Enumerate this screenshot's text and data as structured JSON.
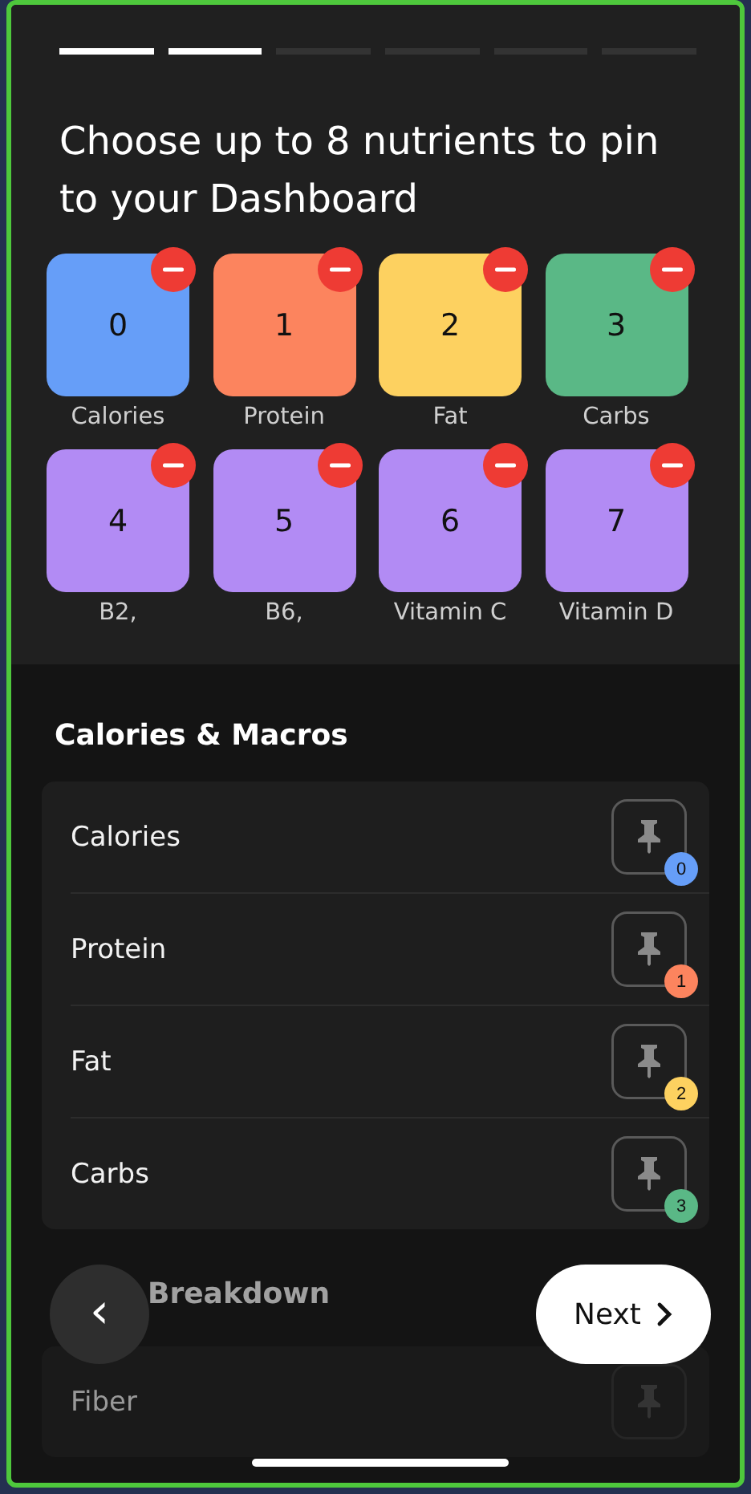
{
  "progress": [
    {
      "done": true
    },
    {
      "done": true
    },
    {
      "done": false
    },
    {
      "done": false
    },
    {
      "done": false
    },
    {
      "done": false
    }
  ],
  "title": "Choose up to 8 nutrients to pin to your Dashboard",
  "pinned": [
    {
      "index": "0",
      "label": "Calories",
      "color": "#669ef8"
    },
    {
      "index": "1",
      "label": "Protein",
      "color": "#fc845e"
    },
    {
      "index": "2",
      "label": "Fat",
      "color": "#fdd160"
    },
    {
      "index": "3",
      "label": "Carbs",
      "color": "#5ab886"
    },
    {
      "index": "4",
      "label": "B2,",
      "color": "#b28bf4"
    },
    {
      "index": "5",
      "label": "B6,",
      "color": "#b28bf4"
    },
    {
      "index": "6",
      "label": "Vitamin C",
      "color": "#b28bf4"
    },
    {
      "index": "7",
      "label": "Vitamin D",
      "color": "#b28bf4"
    }
  ],
  "sections": [
    {
      "title": "Calories & Macros",
      "items": [
        {
          "name": "Calories",
          "pinned": true,
          "badge": "0",
          "color": "#669ef8"
        },
        {
          "name": "Protein",
          "pinned": true,
          "badge": "1",
          "color": "#fc845e"
        },
        {
          "name": "Fat",
          "pinned": true,
          "badge": "2",
          "color": "#fdd160"
        },
        {
          "name": "Carbs",
          "pinned": true,
          "badge": "3",
          "color": "#5ab886"
        }
      ]
    },
    {
      "title": "Breakdown",
      "items": [
        {
          "name": "Fiber",
          "pinned": false
        }
      ]
    }
  ],
  "back_button": {
    "label": "‹"
  },
  "next_button": {
    "label": "Next"
  }
}
